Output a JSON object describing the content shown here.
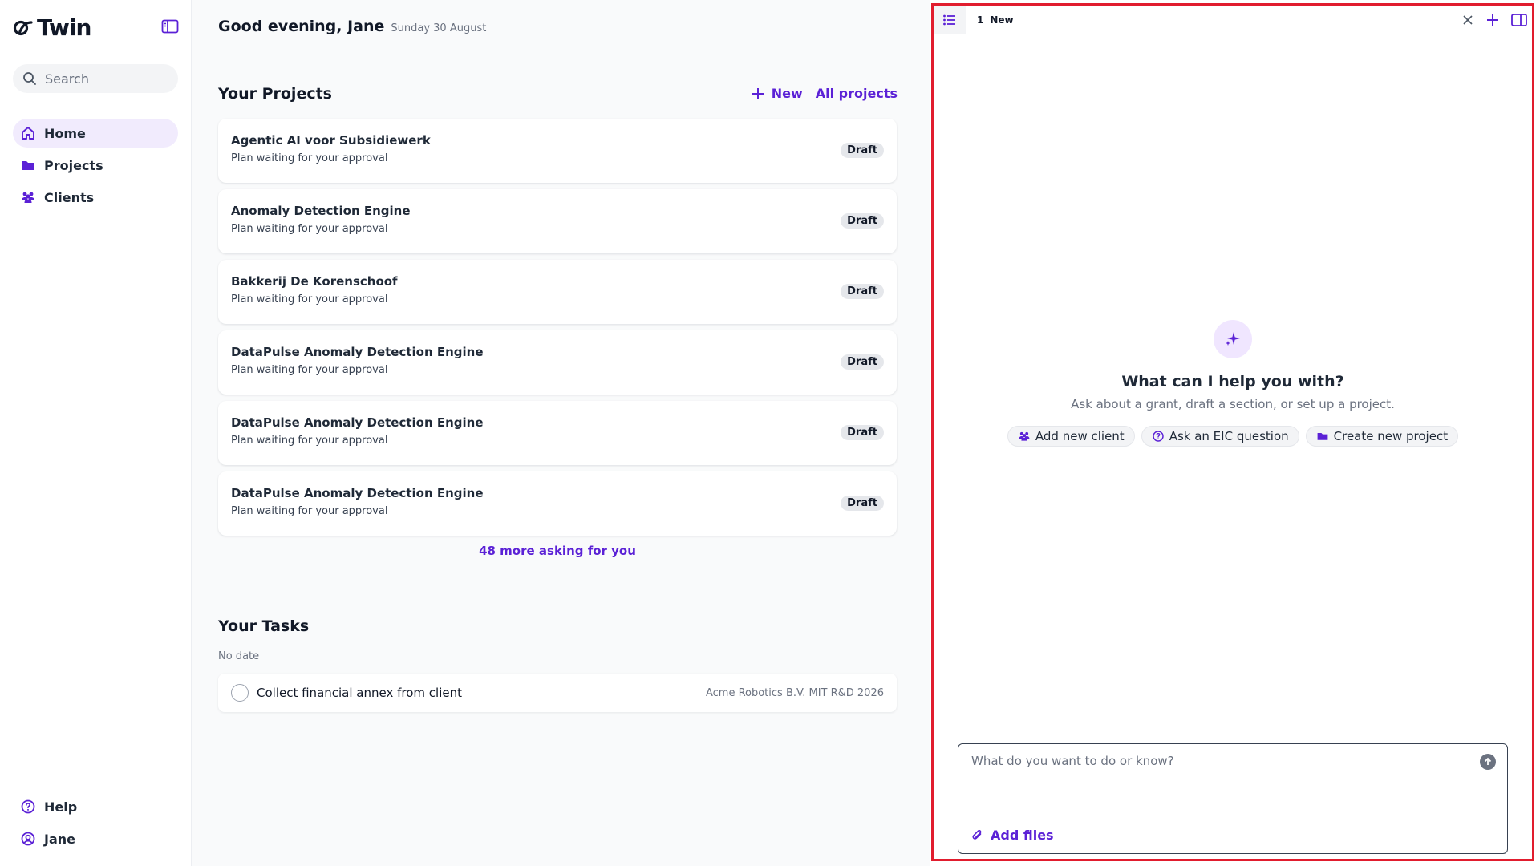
{
  "app": {
    "logo_text": "Twin",
    "accent_color": "#5b21d6",
    "highlight_border_color": "#e11d2e"
  },
  "sidebar": {
    "search_placeholder": "Search",
    "nav": [
      {
        "label": "Home",
        "icon": "home-icon",
        "active": true
      },
      {
        "label": "Projects",
        "icon": "folder-icon",
        "active": false
      },
      {
        "label": "Clients",
        "icon": "users-icon",
        "active": false
      }
    ],
    "bottom": [
      {
        "label": "Help",
        "icon": "help-icon"
      },
      {
        "label": "Jane",
        "icon": "user-circle-icon"
      }
    ]
  },
  "main": {
    "greeting": "Good evening, Jane",
    "date": "Sunday 30 August",
    "projects": {
      "title": "Your Projects",
      "new_label": "New",
      "all_label": "All projects",
      "items": [
        {
          "name": "Agentic AI voor Subsidiewerk",
          "status": "Plan waiting for your approval",
          "badge": "Draft"
        },
        {
          "name": "Anomaly Detection Engine",
          "status": "Plan waiting for your approval",
          "badge": "Draft"
        },
        {
          "name": "Bakkerij De Korenschoof",
          "status": "Plan waiting for your approval",
          "badge": "Draft"
        },
        {
          "name": "DataPulse Anomaly Detection Engine",
          "status": "Plan waiting for your approval",
          "badge": "Draft"
        },
        {
          "name": "DataPulse Anomaly Detection Engine",
          "status": "Plan waiting for your approval",
          "badge": "Draft"
        },
        {
          "name": "DataPulse Anomaly Detection Engine",
          "status": "Plan waiting for your approval",
          "badge": "Draft"
        }
      ],
      "more_label": "48 more asking for you"
    },
    "tasks": {
      "title": "Your Tasks",
      "group_label": "No date",
      "items": [
        {
          "label": "Collect financial annex from client",
          "meta": "Acme Robotics B.V. MIT R&D 2026"
        }
      ]
    }
  },
  "panel": {
    "tab": {
      "number": "1",
      "label": "New"
    },
    "empty_title": "What can I help you with?",
    "empty_subtitle": "Ask about a grant, draft a section, or set up a project.",
    "chips": [
      {
        "label": "Add new client",
        "icon": "users-icon"
      },
      {
        "label": "Ask an EIC question",
        "icon": "help-icon"
      },
      {
        "label": "Create new project",
        "icon": "folder-icon"
      }
    ],
    "composer_placeholder": "What do you want to do or know?",
    "add_files_label": "Add files"
  }
}
